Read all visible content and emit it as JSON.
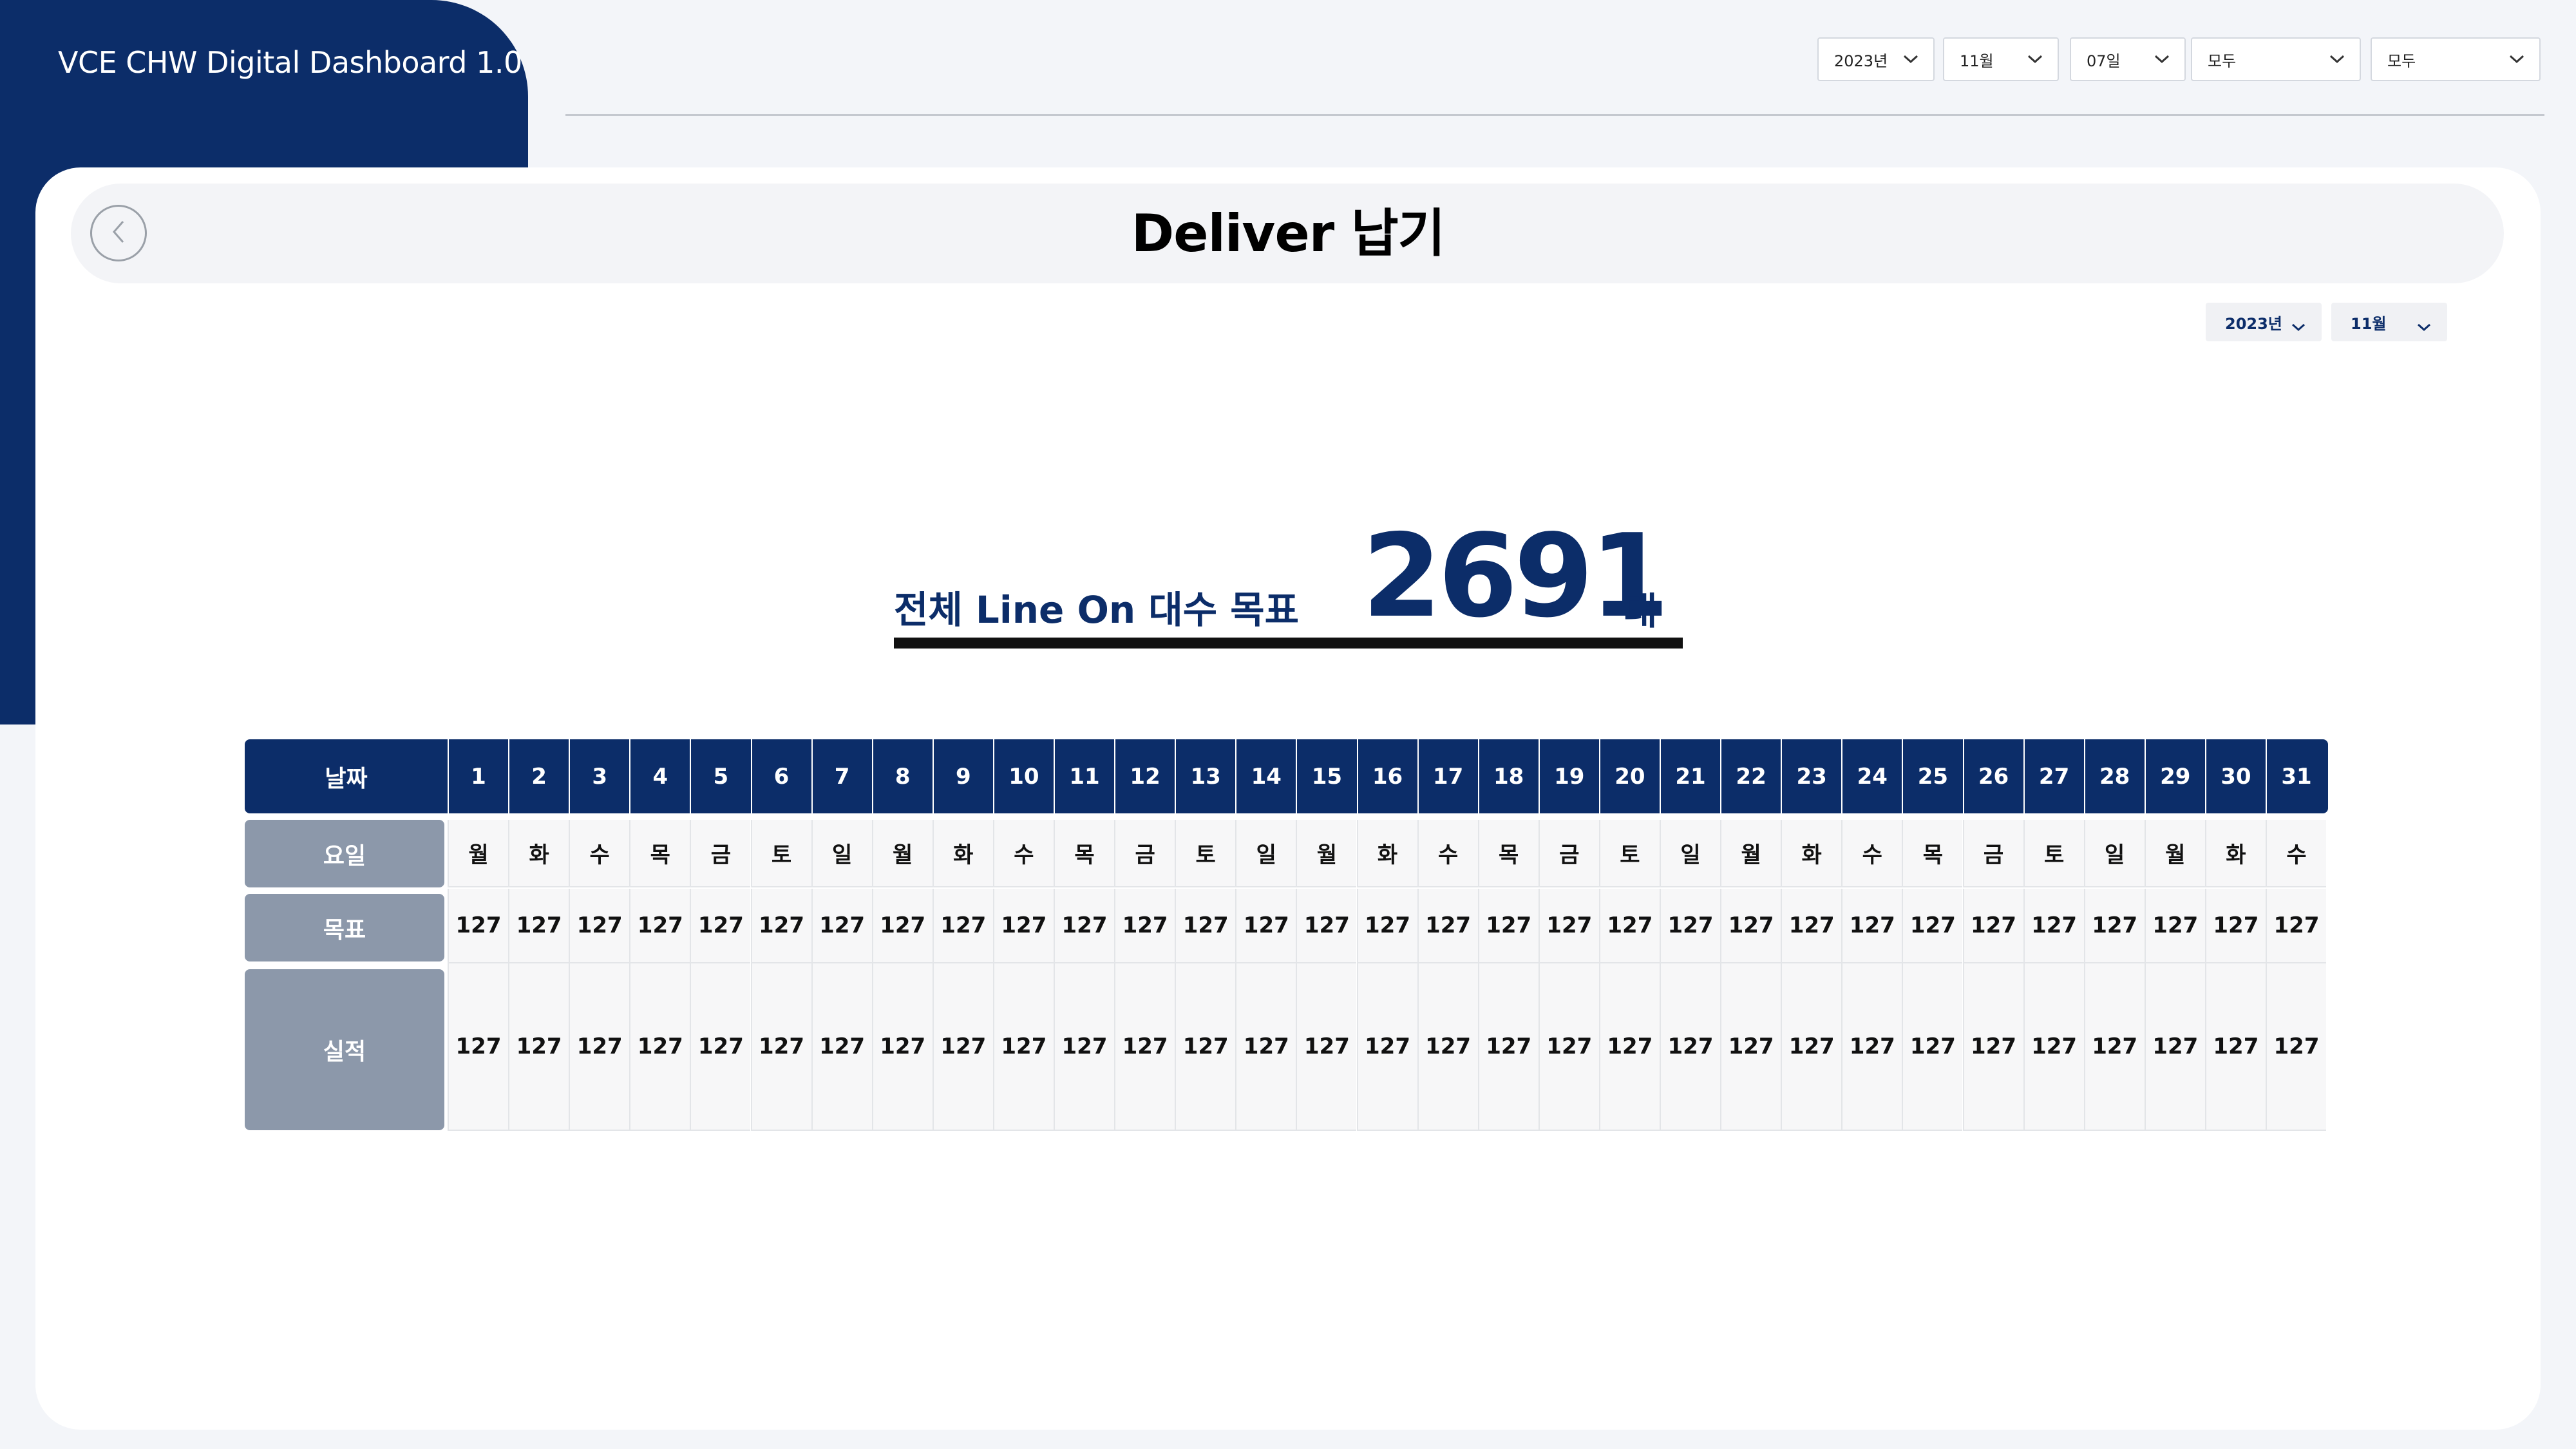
{
  "app": {
    "title": "VCE CHW Digital Dashboard 1.0"
  },
  "filters": [
    {
      "id": "year",
      "value": "2023년"
    },
    {
      "id": "month",
      "value": "11월"
    },
    {
      "id": "day",
      "value": "07일"
    },
    {
      "id": "category1",
      "value": "모두"
    },
    {
      "id": "category2",
      "value": "모두"
    }
  ],
  "page": {
    "title": "Deliver 납기",
    "sub_filters": [
      {
        "id": "year",
        "value": "2023년"
      },
      {
        "id": "month",
        "value": "11월"
      }
    ]
  },
  "headline": {
    "label": "전체 Line On 대수 목표",
    "value": "2691",
    "unit": "대"
  },
  "table": {
    "row_labels": {
      "date": "날짜",
      "weekday": "요일",
      "target": "목표",
      "actual": "실적"
    },
    "days": [
      "1",
      "2",
      "3",
      "4",
      "5",
      "6",
      "7",
      "8",
      "9",
      "10",
      "11",
      "12",
      "13",
      "14",
      "15",
      "16",
      "17",
      "18",
      "19",
      "20",
      "21",
      "22",
      "23",
      "24",
      "25",
      "26",
      "27",
      "28",
      "29",
      "30",
      "31"
    ],
    "weekdays": [
      "월",
      "화",
      "수",
      "목",
      "금",
      "토",
      "일",
      "월",
      "화",
      "수",
      "목",
      "금",
      "토",
      "일",
      "월",
      "화",
      "수",
      "목",
      "금",
      "토",
      "일",
      "월",
      "화",
      "수",
      "목",
      "금",
      "토",
      "일",
      "월",
      "화",
      "수"
    ],
    "targets": [
      "127",
      "127",
      "127",
      "127",
      "127",
      "127",
      "127",
      "127",
      "127",
      "127",
      "127",
      "127",
      "127",
      "127",
      "127",
      "127",
      "127",
      "127",
      "127",
      "127",
      "127",
      "127",
      "127",
      "127",
      "127",
      "127",
      "127",
      "127",
      "127",
      "127",
      "127"
    ],
    "actuals": [
      "127",
      "127",
      "127",
      "127",
      "127",
      "127",
      "127",
      "127",
      "127",
      "127",
      "127",
      "127",
      "127",
      "127",
      "127",
      "127",
      "127",
      "127",
      "127",
      "127",
      "127",
      "127",
      "127",
      "127",
      "127",
      "127",
      "127",
      "127",
      "127",
      "127",
      "127"
    ]
  },
  "colors": {
    "brand": "#0c2d69",
    "row_label_bg": "#8c98aa",
    "card_bg": "#ffffff",
    "page_bg": "#f3f5f9"
  }
}
